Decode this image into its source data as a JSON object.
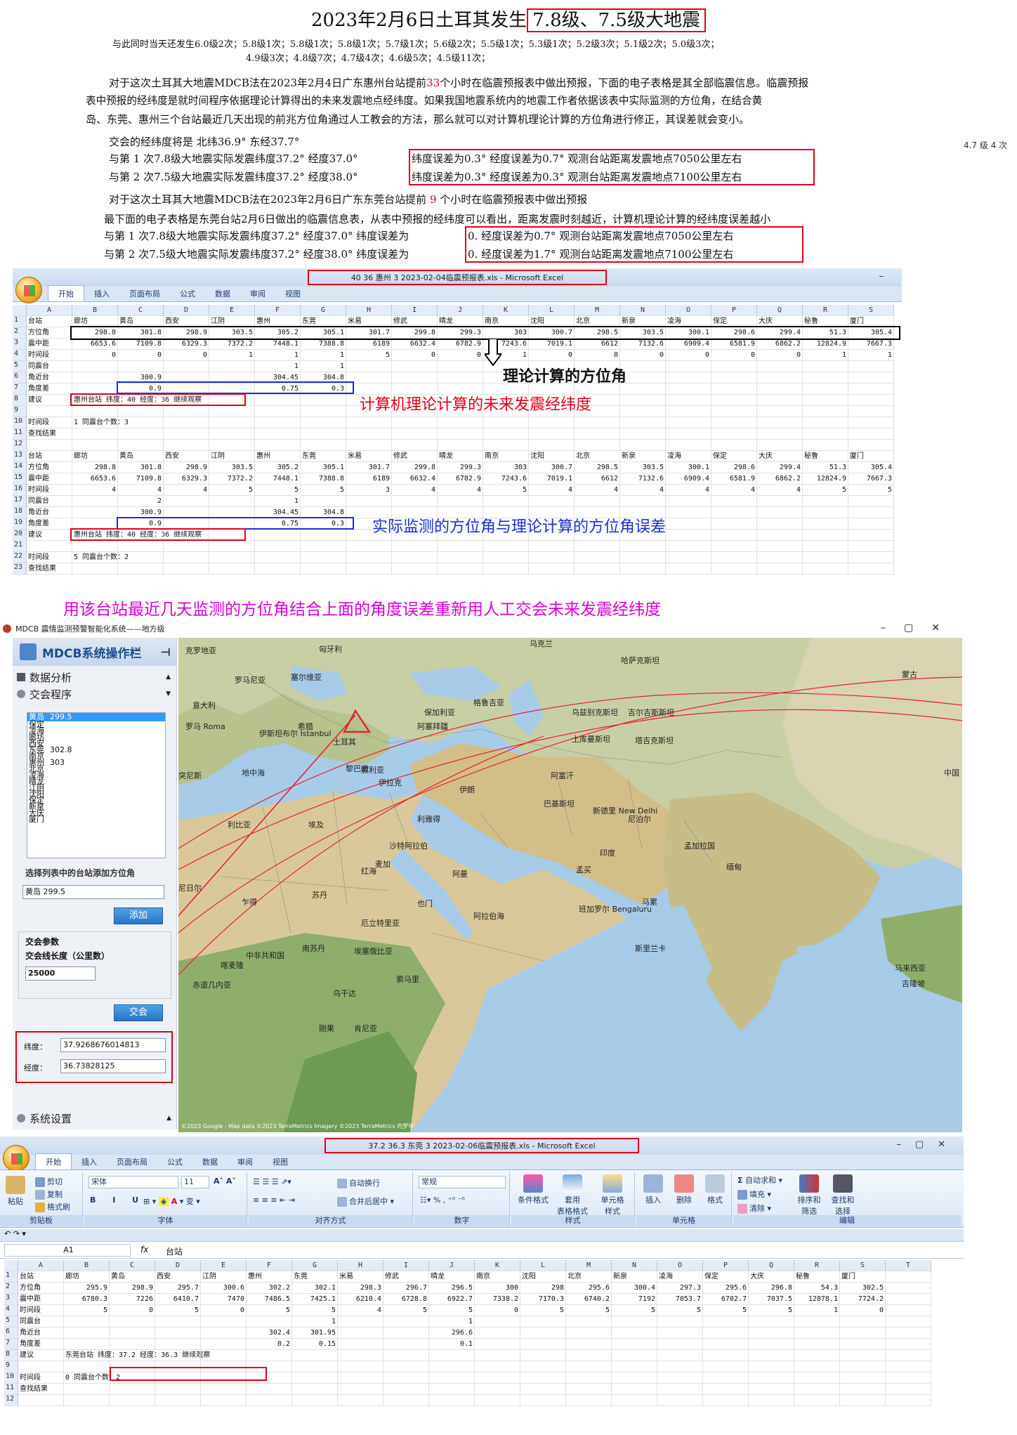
{
  "article": {
    "title_prefix": "2023年2月6日土耳其发生",
    "title_boxed": "7.8级、7.5级大地震",
    "line1": "与此同时当天还发生6.0级2次；5.8级1次；5.8级1次；5.8级1次；5.7级1次；5.6级2次；5.5级1次；5.3级1次；5.2级3次；5.1级2次；5.0级3次；",
    "line2": "4.9级3次；4.8级7次；4.7级4次；4.6级5次；4.5级11次；",
    "side_note": "4.7 级 4 次",
    "para1a": "对于这次土耳其大地震MDCB法在2023年2月4日广东惠州台站提前",
    "para1_hours": "33",
    "para1b": "个小时在临震预报表中做出预报，下面的电子表格是其全部临震信息。临震预报",
    "para1c": "表中预报的经纬度是就时间程序依据理论计算得出的未来发震地点经纬度。如果我国地震系统内的地震工作者依据该表中实际监测的方位角，在结合黄",
    "para1d": "岛、东莞、惠州三个台站最近几天出现的前兆方位角通过人工教会的方法，那么就可以对计算机理论计算的方位角进行修正，其误差就会变小。",
    "intersect": "交会的经纬度将是  北纬36.9°   东经37.7°",
    "q1_left": "与第 1 次7.8级大地震实际发震纬度37.2°   经度37.0°",
    "q1_box": "纬度误差为0.3°  经度误差为0.7°    观测台站距离发震地点7050公里左右",
    "q2_left": "与第 2 次7.5级大地震实际发震纬度37.2°   经度38.0°",
    "q2_box": "纬度误差为0.3°  经度误差为0.3°    观测台站距离发震地点7100公里左右",
    "para2a": "对于这次土耳其大地震MDCB法在2023年2月6日广东东莞台站提前",
    "para2_hours": "9",
    "para2b": "个小时在临震预报表中做出预报",
    "para2c": "最下面的电子表格是东莞台站2月6日做出的临震信息表，从表中预报的经纬度可以看出，距离发震时刻越近，计算机理论计算的经纬度误差越小",
    "q3_left": "与第 1 次7.8级大地震实际发震纬度37.2°   经度37.0°   纬度误差为",
    "q3_box": "0.   经度误差为0.7°   观测台站距离发震地点7050公里左右",
    "q4_left": "与第 2 次7.5级大地震实际发震纬度37.2°   经度38.0°   纬度误差为",
    "q4_box": "0.   经度误差为1.7°   观测台站距离发震地点7100公里左右",
    "annot_theory": "理论计算的方位角",
    "annot_predict": "计算机理论计算的未来发震经纬度",
    "annot_actual": "实际监测的方位角与理论计算的方位角误差",
    "middle_heading": "用该台站最近几天监测的方位角结合上面的角度误差重新用人工交会未来发震经纬度"
  },
  "excel1": {
    "title": "40 36 惠州 3 2023-02-04临震预报表.xls - Microsoft Excel",
    "tabs": [
      "开始",
      "插入",
      "页面布局",
      "公式",
      "数据",
      "审阅",
      "视图"
    ],
    "col_headers": [
      "A",
      "B",
      "C",
      "D",
      "E",
      "F",
      "G",
      "H",
      "I",
      "J",
      "K",
      "L",
      "M",
      "N",
      "O",
      "P",
      "Q",
      "R",
      "S"
    ],
    "rows": [
      [
        "1",
        "台站",
        "廊坊",
        "黄岛",
        "西安",
        "江阴",
        "惠州",
        "东莞",
        "米易",
        "修武",
        "晴龙",
        "南京",
        "沈阳",
        "北京",
        "新泉",
        "凌海",
        "保定",
        "大庆",
        "秘鲁",
        "厦门"
      ],
      [
        "2",
        "方位角",
        "298.8",
        "301.8",
        "298.9",
        "303.5",
        "305.2",
        "305.1",
        "301.7",
        "299.8",
        "299.3",
        "303",
        "300.7",
        "298.5",
        "303.5",
        "300.1",
        "298.6",
        "299.4",
        "51.3",
        "305.4"
      ],
      [
        "3",
        "震中距",
        "6653.6",
        "7109.8",
        "6329.3",
        "7372.2",
        "7448.1",
        "7388.8",
        "6189",
        "6632.4",
        "6782.9",
        "7243.6",
        "7019.1",
        "6612",
        "7132.6",
        "6909.4",
        "6581.9",
        "6862.2",
        "12824.9",
        "7667.3"
      ],
      [
        "4",
        "时间段",
        "0",
        "0",
        "0",
        "1",
        "1",
        "1",
        "5",
        "0",
        "0",
        "1",
        "0",
        "0",
        "0",
        "0",
        "0",
        "0",
        "1",
        "1"
      ],
      [
        "5",
        "同震台",
        "",
        "",
        "",
        "",
        "1",
        "1",
        "",
        "",
        "",
        "",
        "",
        "",
        "",
        "",
        "",
        "",
        "",
        ""
      ],
      [
        "6",
        "角近台",
        "",
        "300.9",
        "",
        "",
        "304.45",
        "304.8",
        "",
        "",
        "",
        "",
        "",
        "",
        "",
        "",
        "",
        "",
        "",
        ""
      ],
      [
        "7",
        "角度差",
        "",
        "0.9",
        "",
        "",
        "0.75",
        "0.3",
        "",
        "",
        "",
        "",
        "",
        "",
        "",
        "",
        "",
        "",
        "",
        ""
      ],
      [
        "8",
        "建议",
        "惠州台站 纬度：40 经度：36 继续观察",
        "",
        "",
        "",
        "",
        "",
        "",
        "",
        "",
        "",
        "",
        "",
        "",
        "",
        "",
        "",
        "",
        ""
      ],
      [
        "9",
        "",
        "",
        "",
        "",
        "",
        "",
        "",
        "",
        "",
        "",
        "",
        "",
        "",
        "",
        "",
        "",
        "",
        "",
        ""
      ],
      [
        "10",
        "时间段",
        "1  同震台个数：3",
        "",
        "",
        "",
        "",
        "",
        "",
        "",
        "",
        "",
        "",
        "",
        "",
        "",
        "",
        "",
        "",
        ""
      ],
      [
        "11",
        "查找结果",
        "",
        "",
        "",
        "",
        "",
        "",
        "",
        "",
        "",
        "",
        "",
        "",
        "",
        "",
        "",
        "",
        "",
        ""
      ],
      [
        "12",
        "",
        "",
        "",
        "",
        "",
        "",
        "",
        "",
        "",
        "",
        "",
        "",
        "",
        "",
        "",
        "",
        "",
        "",
        ""
      ],
      [
        "13",
        "台站",
        "廊坊",
        "黄岛",
        "西安",
        "江阴",
        "惠州",
        "东莞",
        "米易",
        "修武",
        "晴龙",
        "南京",
        "沈阳",
        "北京",
        "新泉",
        "凌海",
        "保定",
        "大庆",
        "秘鲁",
        "厦门"
      ],
      [
        "14",
        "方位角",
        "298.8",
        "301.8",
        "298.9",
        "303.5",
        "305.2",
        "305.1",
        "301.7",
        "299.8",
        "299.3",
        "303",
        "300.7",
        "298.5",
        "303.5",
        "300.1",
        "298.6",
        "299.4",
        "51.3",
        "305.4"
      ],
      [
        "15",
        "震中距",
        "6653.6",
        "7109.8",
        "6329.3",
        "7372.2",
        "7448.1",
        "7388.8",
        "6189",
        "6632.4",
        "6782.9",
        "7243.6",
        "7019.1",
        "6612",
        "7132.6",
        "6909.4",
        "6581.9",
        "6862.2",
        "12824.9",
        "7667.3"
      ],
      [
        "16",
        "时间段",
        "4",
        "4",
        "4",
        "5",
        "5",
        "5",
        "3",
        "4",
        "4",
        "5",
        "4",
        "4",
        "4",
        "4",
        "4",
        "4",
        "5",
        "5"
      ],
      [
        "17",
        "同震台",
        "",
        "2",
        "",
        "",
        "1",
        "",
        "",
        "",
        "",
        "",
        "",
        "",
        "",
        "",
        "",
        "",
        "",
        ""
      ],
      [
        "18",
        "角近台",
        "",
        "300.9",
        "",
        "",
        "304.45",
        "304.8",
        "",
        "",
        "",
        "",
        "",
        "",
        "",
        "",
        "",
        "",
        "",
        ""
      ],
      [
        "19",
        "角度差",
        "",
        "0.9",
        "",
        "",
        "0.75",
        "0.3",
        "",
        "",
        "",
        "",
        "",
        "",
        "",
        "",
        "",
        "",
        "",
        ""
      ],
      [
        "20",
        "建议",
        "惠州台站 纬度：40 经度：36 继续观察",
        "",
        "",
        "",
        "",
        "",
        "",
        "",
        "",
        "",
        "",
        "",
        "",
        "",
        "",
        "",
        "",
        ""
      ],
      [
        "21",
        "",
        "",
        "",
        "",
        "",
        "",
        "",
        "",
        "",
        "",
        "",
        "",
        "",
        "",
        "",
        "",
        "",
        "",
        ""
      ],
      [
        "22",
        "时间段",
        "5  同震台个数：2",
        "",
        "",
        "",
        "",
        "",
        "",
        "",
        "",
        "",
        "",
        "",
        "",
        "",
        "",
        "",
        "",
        ""
      ],
      [
        "23",
        "查找结果",
        "",
        "",
        "",
        "",
        "",
        "",
        "",
        "",
        "",
        "",
        "",
        "",
        "",
        "",
        "",
        "",
        "",
        ""
      ]
    ]
  },
  "mdcb": {
    "window_title": "MDCB 震情监测预警智能化系统——地方级",
    "panel_title": "MDCB系统操作栏",
    "menu_data": "数据分析",
    "menu_intersect": "交会程序",
    "list": [
      {
        "name": "黄岛",
        "value": "299.5",
        "selected": true
      },
      {
        "name": "保定",
        "value": ""
      },
      {
        "name": "凌海",
        "value": ""
      },
      {
        "name": "廊坊",
        "value": ""
      },
      {
        "name": "西安",
        "value": ""
      },
      {
        "name": "东莞",
        "value": "302.8"
      },
      {
        "name": "南京",
        "value": ""
      },
      {
        "name": "惠州",
        "value": "303"
      },
      {
        "name": "北京",
        "value": ""
      },
      {
        "name": "凌海",
        "value": ""
      },
      {
        "name": "晴龙",
        "value": ""
      },
      {
        "name": "江阴",
        "value": ""
      },
      {
        "name": "沈阳",
        "value": ""
      },
      {
        "name": "保定",
        "value": ""
      },
      {
        "name": "新泉",
        "value": ""
      },
      {
        "name": "大庆",
        "value": ""
      },
      {
        "name": "厦门",
        "value": ""
      }
    ],
    "select_hint": "选择列表中的台站添加方位角",
    "select_value": "黄岛  299.5",
    "add_btn": "添加",
    "params_title": "交会参数",
    "line_len_label": "交会线长度（公里数）",
    "line_len_value": "25000",
    "intersect_btn": "交会",
    "lat_label": "纬度：",
    "lat_value": "37.9268676014813",
    "lon_label": "经度：",
    "lon_value": "36.73828125",
    "settings": "系统设置",
    "map_credit": "©2023 Google - Map data ©2023 TerraMetrics Imagery ©2023 TerraMetrics  内罗毕",
    "map_labels": [
      "克罗地亚",
      "匈牙利",
      "乌克兰",
      "哈萨克斯坦",
      "蒙古",
      "罗马尼亚",
      "塞尔维亚",
      "意大利",
      "罗马 Roma",
      "保加利亚",
      "格鲁吉亚",
      "阿塞拜疆",
      "希腊",
      "伊斯坦布尔 İstanbul",
      "土耳其",
      "乌兹别克斯坦",
      "吉尔吉斯斯坦",
      "土库曼斯坦",
      "塔吉克斯坦",
      "中国",
      "地中海",
      "突尼斯",
      "黎巴嫩",
      "叙利亚",
      "伊拉克",
      "伊朗",
      "阿富汗",
      "巴基斯坦",
      "新德里 New Delhi",
      "尼泊尔",
      "利比亚",
      "埃及",
      "沙特阿拉伯",
      "利雅得",
      "麦加",
      "印度",
      "孟加拉国",
      "缅甸",
      "红海",
      "阿曼",
      "尼日尔",
      "乍得",
      "苏丹",
      "厄立特里亚",
      "也门",
      "阿拉伯海",
      "班加罗尔 Bengaluru",
      "中非共和国",
      "南苏丹",
      "埃塞俄比亚",
      "索马里",
      "斯里兰卡",
      "马来西亚",
      "喀麦隆",
      "乌干达",
      "肯尼亚",
      "刚果",
      "赤道几内亚",
      "孟买",
      "马累",
      "吉隆坡"
    ]
  },
  "excel2": {
    "title": "37.2 36.3 东莞 3 2023-02-06临震预报表.xls - Microsoft Excel",
    "tabs": [
      "开始",
      "插入",
      "页面布局",
      "公式",
      "数据",
      "审阅",
      "视图"
    ],
    "ribbon": {
      "cut": "剪切",
      "copy": "复制",
      "paste": "粘贴",
      "painter": "格式刷",
      "clipboard": "剪贴板",
      "font_name": "宋体",
      "font_size": "11",
      "font_group": "字体",
      "wrap": "自动换行",
      "merge": "合并后居中",
      "align_group": "对齐方式",
      "num_fmt": "常规",
      "num_group": "数字",
      "cond": "条件格式",
      "table": "套用\n表格格式",
      "cellstyle": "单元格\n样式",
      "style_group": "样式",
      "insert": "插入",
      "delete": "删除",
      "format": "格式",
      "cells_group": "单元格",
      "autosum": "自动求和",
      "fill": "填充",
      "clear": "清除",
      "sort": "排序和\n筛选",
      "find": "查找和\n选择",
      "edit_group": "编辑"
    },
    "name_box": "A1",
    "formula": "台站",
    "col_headers": [
      "A",
      "B",
      "C",
      "D",
      "E",
      "F",
      "G",
      "H",
      "I",
      "J",
      "K",
      "L",
      "M",
      "N",
      "O",
      "P",
      "Q",
      "R",
      "S",
      "T"
    ],
    "rows": [
      [
        "1",
        "台站",
        "廊坊",
        "黄岛",
        "西安",
        "江阴",
        "惠州",
        "东莞",
        "米易",
        "修武",
        "晴龙",
        "南京",
        "沈阳",
        "北京",
        "新泉",
        "凌海",
        "保定",
        "大庆",
        "秘鲁",
        "厦门",
        ""
      ],
      [
        "2",
        "方位角",
        "295.9",
        "298.9",
        "295.7",
        "300.6",
        "302.2",
        "302.1",
        "298.3",
        "296.7",
        "296.5",
        "300",
        "298",
        "295.6",
        "300.4",
        "297.3",
        "295.6",
        "296.8",
        "54.3",
        "302.5",
        ""
      ],
      [
        "3",
        "震中距",
        "6780.3",
        "7226",
        "6410.7",
        "7470",
        "7486.5",
        "7425.1",
        "6210.4",
        "6728.8",
        "6922.7",
        "7338.2",
        "7170.3",
        "6740.2",
        "7192",
        "7053.7",
        "6702.7",
        "7037.5",
        "12878.1",
        "7724.2",
        ""
      ],
      [
        "4",
        "时间段",
        "5",
        "0",
        "5",
        "0",
        "5",
        "5",
        "4",
        "5",
        "5",
        "0",
        "5",
        "5",
        "5",
        "5",
        "5",
        "5",
        "1",
        "0",
        ""
      ],
      [
        "5",
        "同震台",
        "",
        "",
        "",
        "",
        "",
        "1",
        "",
        "",
        "1",
        "",
        "",
        "",
        "",
        "",
        "",
        "",
        "",
        "",
        ""
      ],
      [
        "6",
        "角近台",
        "",
        "",
        "",
        "",
        "302.4",
        "301.95",
        "",
        "",
        "296.6",
        "",
        "",
        "",
        "",
        "",
        "",
        "",
        "",
        "",
        ""
      ],
      [
        "7",
        "角度差",
        "",
        "",
        "",
        "",
        "0.2",
        "0.15",
        "",
        "",
        "0.1",
        "",
        "",
        "",
        "",
        "",
        "",
        "",
        "",
        "",
        ""
      ],
      [
        "8",
        "建议",
        "东莞台站 纬度：37.2 经度：36.3 继续观察",
        "",
        "",
        "",
        "",
        "",
        "",
        "",
        "",
        "",
        "",
        "",
        "",
        "",
        "",
        "",
        "",
        "",
        ""
      ],
      [
        "9",
        "",
        "",
        "",
        "",
        "",
        "",
        "",
        "",
        "",
        "",
        "",
        "",
        "",
        "",
        "",
        "",
        "",
        "",
        "",
        ""
      ],
      [
        "10",
        "时间段",
        "0  同震台个数：2",
        "",
        "",
        "",
        "",
        "",
        "",
        "",
        "",
        "",
        "",
        "",
        "",
        "",
        "",
        "",
        "",
        "",
        ""
      ],
      [
        "11",
        "查找结果",
        "",
        "",
        "",
        "",
        "",
        "",
        "",
        "",
        "",
        "",
        "",
        "",
        "",
        "",
        "",
        "",
        "",
        "",
        ""
      ],
      [
        "12",
        "",
        "",
        "",
        "",
        "",
        "",
        "",
        "",
        "",
        "",
        "",
        "",
        "",
        "",
        "",
        "",
        "",
        "",
        "",
        ""
      ]
    ]
  }
}
